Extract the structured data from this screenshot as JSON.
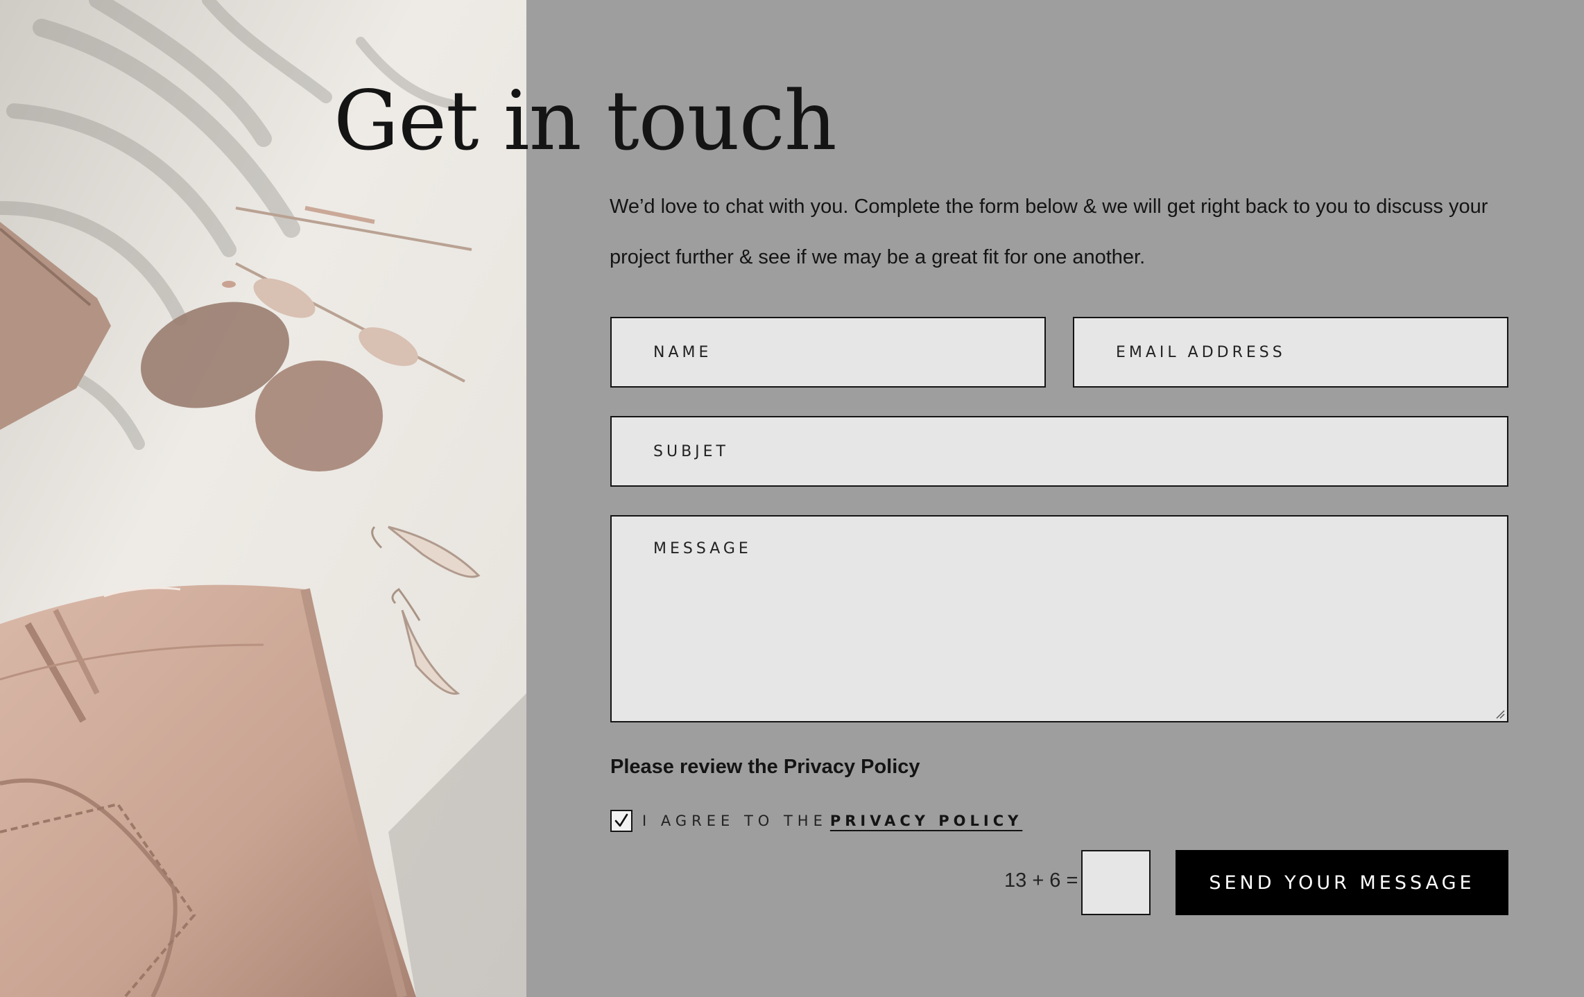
{
  "header": {
    "title": "Get in touch",
    "intro": "We’d love to chat with you.  Complete the form below & we will get right back to you to discuss your project further & see if we may be a great fit for one another."
  },
  "form": {
    "name_placeholder": "NAME",
    "email_placeholder": "EMAIL ADDRESS",
    "subject_placeholder": "SUBJET",
    "message_placeholder": "MESSAGE",
    "privacy_heading": "Please review the Privacy Policy",
    "agree_text": "I AGREE TO THE",
    "privacy_link": "PRIVACY POLICY",
    "agree_checked": true,
    "captcha_question": "13 + 6 =",
    "captcha_value": "",
    "submit_label": "SEND YOUR MESSAGE"
  },
  "icons": {
    "checkbox": "checkmark-icon",
    "resize": "resize-grip-icon"
  },
  "colors": {
    "panel_bg": "#9e9e9e",
    "field_bg": "#e6e6e6",
    "button_bg": "#000000",
    "button_text": "#ffffff",
    "text": "#141414"
  }
}
